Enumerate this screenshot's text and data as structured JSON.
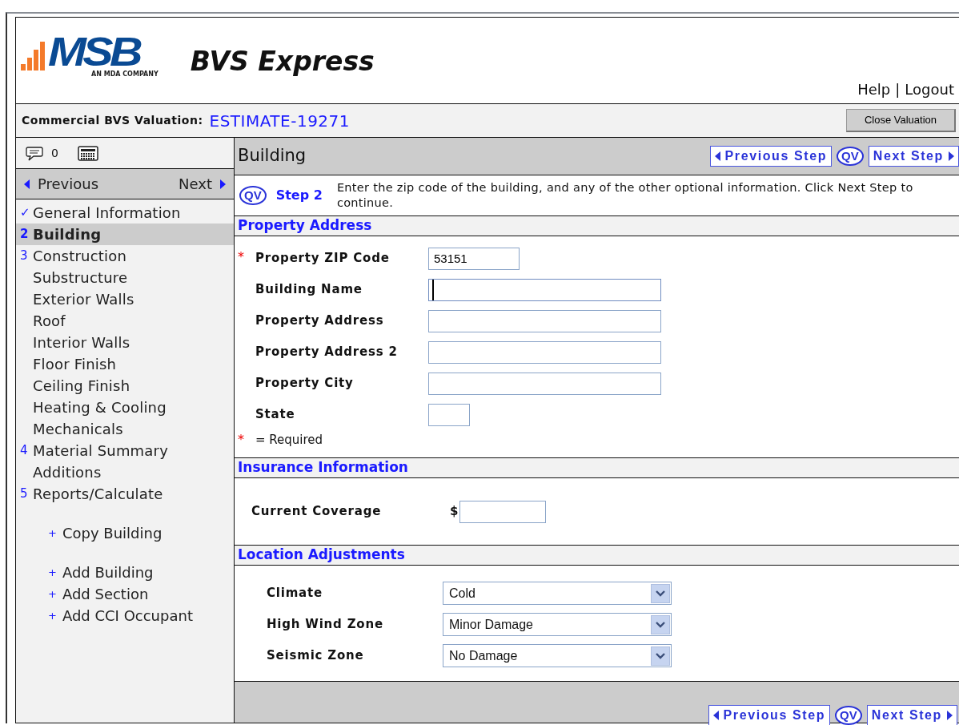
{
  "header": {
    "logo_text": "MSB",
    "logo_tagline": "AN MDA COMPANY",
    "brand": "BVS Express",
    "links": [
      "Help",
      "Logout"
    ],
    "separator": "|"
  },
  "valuation": {
    "label": "Commercial BVS Valuation:",
    "estimate": "ESTIMATE-19271",
    "close_button": "Close Valuation"
  },
  "sidebar": {
    "comment_count": "0",
    "previous": "Previous",
    "next": "Next",
    "items": [
      {
        "label": "General Information",
        "marker": "✓",
        "selected": false
      },
      {
        "label": "Building",
        "marker": "2",
        "selected": true
      },
      {
        "label": "Construction",
        "marker": "3",
        "selected": false
      },
      {
        "label": "Substructure",
        "selected": false
      },
      {
        "label": "Exterior Walls",
        "selected": false
      },
      {
        "label": "Roof",
        "selected": false
      },
      {
        "label": "Interior Walls",
        "selected": false
      },
      {
        "label": "Floor Finish",
        "selected": false
      },
      {
        "label": "Ceiling Finish",
        "selected": false
      },
      {
        "label": "Heating & Cooling",
        "selected": false
      },
      {
        "label": "Mechanicals",
        "selected": false
      },
      {
        "label": "Material Summary",
        "marker": "4",
        "selected": false
      },
      {
        "label": "Additions",
        "selected": false
      },
      {
        "label": "Reports/Calculate",
        "marker": "5",
        "selected": false
      }
    ],
    "action_groups": [
      [
        {
          "label": "Copy Building",
          "marker": "+"
        }
      ],
      [
        {
          "label": "Add Building",
          "marker": "+"
        },
        {
          "label": "Add Section",
          "marker": "+"
        },
        {
          "label": "Add CCI Occupant",
          "marker": "+"
        }
      ]
    ]
  },
  "main": {
    "title": "Building",
    "previous_step": "Previous Step",
    "qv": "QV",
    "next_step": "Next Step",
    "step": {
      "qv": "QV",
      "label": "Step 2",
      "instruction": "Enter the zip code of the building, and any of the other optional information. Click Next Step to continue."
    },
    "sections": [
      {
        "title": "Property Address",
        "kind": "address",
        "fields": [
          {
            "label": "Property ZIP Code",
            "kind": "short-text",
            "required": true,
            "value": "53151",
            "focused": false
          },
          {
            "label": "Building Name",
            "kind": "text",
            "required": false,
            "focused": true
          },
          {
            "label": "Property Address",
            "kind": "text",
            "required": false,
            "focused": false
          },
          {
            "label": "Property Address 2",
            "kind": "text",
            "required": false,
            "focused": false
          },
          {
            "label": "Property City",
            "kind": "text",
            "required": false,
            "focused": false
          },
          {
            "label": "State",
            "kind": "tiny-text",
            "required": false,
            "focused": false
          }
        ],
        "required_note": {
          "marker": "*",
          "text": "= Required"
        }
      },
      {
        "title": "Insurance Information",
        "kind": "insurance",
        "fields": [
          {
            "label": "Current Coverage",
            "kind": "money",
            "prefix": "$"
          }
        ]
      },
      {
        "title": "Location Adjustments",
        "kind": "location",
        "fields": [
          {
            "label": "Climate",
            "kind": "select",
            "value": "Cold"
          },
          {
            "label": "High Wind Zone",
            "kind": "select",
            "value": "Minor Damage"
          },
          {
            "label": "Seismic Zone",
            "kind": "select",
            "value": "No Damage"
          }
        ]
      }
    ],
    "footer": {
      "previous_step": "Previous Step",
      "qv": "QV",
      "next_step": "Next Step"
    }
  }
}
